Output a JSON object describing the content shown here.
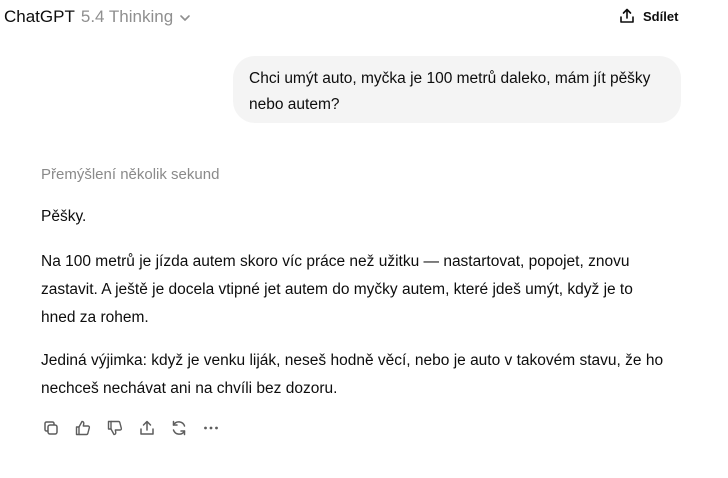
{
  "header": {
    "model_name": "ChatGPT",
    "model_version": "5.4 Thinking",
    "model_icon": "chevron-down-icon",
    "share_label": "Sdílet",
    "share_icon": "share-icon"
  },
  "conversation": {
    "user_message": {
      "line1": "Chci umýt auto, myčka je 100 metrů daleko, mám jít pěšky",
      "line2": "nebo autem?"
    },
    "assistant": {
      "thinking_label": "Přemýšlení několik sekund",
      "answer_short": "Pěšky.",
      "paragraph2": {
        "line1": "Na 100 metrů je jízda autem skoro víc práce než užitku — nastartovat, popojet, znovu",
        "line2": "zastavit. A ještě je docela vtipné jet autem do myčky autem, které jdeš umýt, když je to",
        "line3": "hned za rohem."
      },
      "paragraph3": {
        "line1": "Jediná výjimka: když je venku liják, neseš hodně věcí, nebo je auto v takovém stavu, že ho",
        "line2": "nechceš nechávat ani na chvíli bez dozoru."
      },
      "actions": [
        "copy-icon",
        "thumbs-up-icon",
        "thumbs-down-icon",
        "share-icon",
        "regenerate-icon",
        "more-icon"
      ]
    }
  },
  "colors": {
    "text": "#0d0d0d",
    "muted": "#8f8f8f",
    "bubble": "#f4f4f4",
    "background": "#ffffff"
  }
}
